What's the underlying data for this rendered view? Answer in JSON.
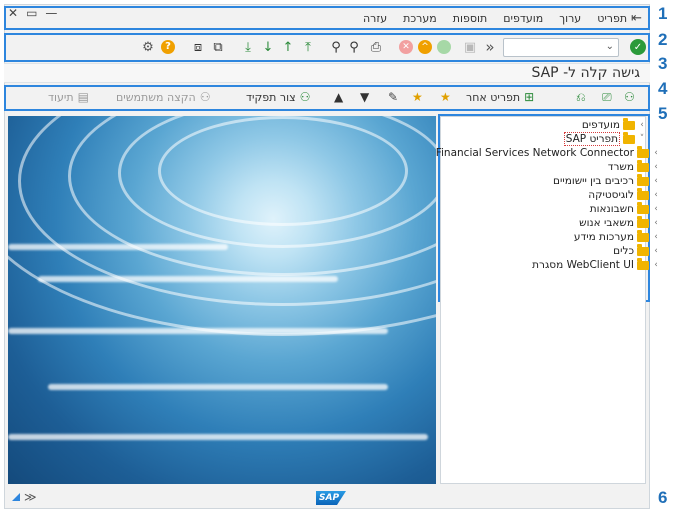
{
  "callouts": [
    "1",
    "2",
    "3",
    "4",
    "5",
    "6"
  ],
  "menu": {
    "items": [
      {
        "label": "תפריט",
        "name": "menu-program"
      },
      {
        "label": "ערוך",
        "name": "menu-edit"
      },
      {
        "label": "מועדפים",
        "name": "menu-favorites"
      },
      {
        "label": "תוספות",
        "name": "menu-extras"
      },
      {
        "label": "מערכת",
        "name": "menu-system"
      },
      {
        "label": "עזרה",
        "name": "menu-help"
      }
    ]
  },
  "window_controls": {
    "close": "✕",
    "restore": "▭",
    "minimize": "—"
  },
  "toolbar": {
    "command_field_value": "",
    "icons": [
      "ok-icon",
      "back-icon",
      "exit-icon",
      "cancel-icon",
      "save-icon",
      "print-icon",
      "find-icon",
      "find-next-icon",
      "first-page-icon",
      "prev-page-icon",
      "next-page-icon",
      "last-page-icon",
      "new-session-icon",
      "shortcut-icon",
      "help-icon",
      "settings-icon"
    ]
  },
  "title": "גישה קלה ל- SAP",
  "app_toolbar": {
    "other_menu": "תפריט אחר",
    "create_role": "צור תפקיד",
    "assign_users": "הקצה משתמשים",
    "documentation": "תיעוד"
  },
  "tree": {
    "items": [
      {
        "label": "מועדפים",
        "chevron": "‹",
        "selected": false
      },
      {
        "label": "תפריט SAP",
        "chevron": "˅",
        "selected": true,
        "open": true
      },
      {
        "label": "Financial Services Network Connector",
        "chevron": "‹",
        "selected": false
      },
      {
        "label": "משרד",
        "chevron": "‹",
        "selected": false
      },
      {
        "label": "רכיבים בין יישומיים",
        "chevron": "‹",
        "selected": false
      },
      {
        "label": "לוגיסטיקה",
        "chevron": "‹",
        "selected": false
      },
      {
        "label": "חשבונאות",
        "chevron": "‹",
        "selected": false
      },
      {
        "label": "משאבי אנוש",
        "chevron": "‹",
        "selected": false
      },
      {
        "label": "מערכות מידע",
        "chevron": "‹",
        "selected": false
      },
      {
        "label": "כלים",
        "chevron": "‹",
        "selected": false
      },
      {
        "label": "WebClient UI מסגרת",
        "chevron": "‹",
        "selected": false
      }
    ]
  },
  "status": {
    "logo": "SAP",
    "arrows": "≫"
  },
  "colors": {
    "accent": "#2e86de",
    "ok": "#2b9a3a",
    "cancel": "#e05555",
    "warn": "#f0a000",
    "folder": "#f0b400"
  }
}
